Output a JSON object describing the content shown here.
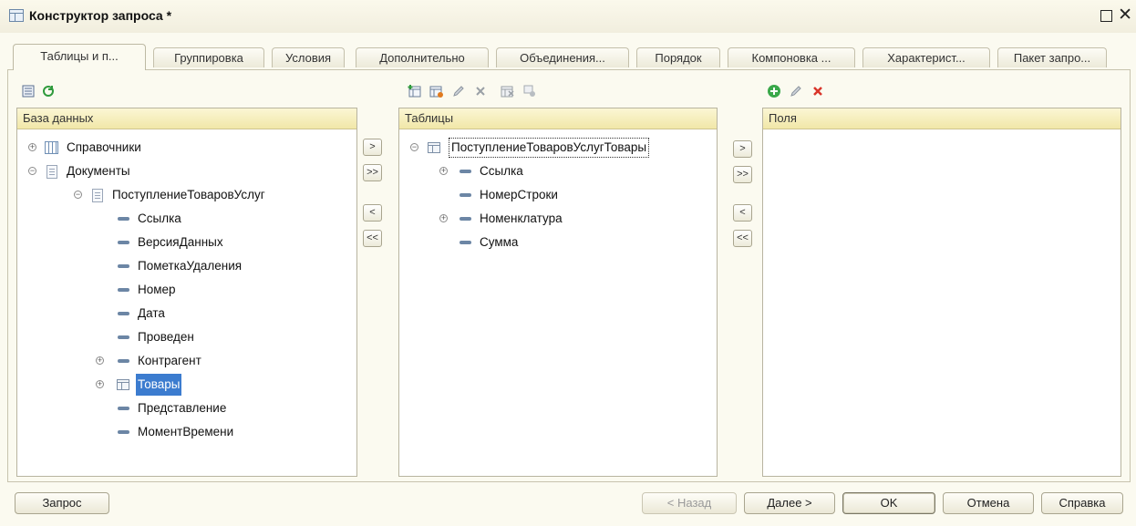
{
  "window": {
    "title": "Конструктор запроса *",
    "maximize_icon": "□",
    "close_icon": "✕"
  },
  "tabs": [
    {
      "label": "Таблицы и п...",
      "active": true
    },
    {
      "label": "Группировка"
    },
    {
      "label": "Условия"
    },
    {
      "label": "Дополнительно"
    },
    {
      "label": "Объединения..."
    },
    {
      "label": "Порядок"
    },
    {
      "label": "Компоновка ..."
    },
    {
      "label": "Характерист..."
    },
    {
      "label": "Пакет запро..."
    }
  ],
  "left_panel": {
    "header": "База данных",
    "toolbar_icons": [
      "query-list-icon",
      "database-refresh-icon"
    ],
    "tree": [
      {
        "label": "Справочники",
        "expander": "⊕",
        "icon": "catalog"
      },
      {
        "label": "Документы",
        "expander": "⊖",
        "icon": "doc"
      },
      {
        "label": "ПоступлениеТоваровУслуг",
        "expander": "⊖",
        "icon": "doc"
      },
      {
        "label": "Ссылка",
        "icon": "field"
      },
      {
        "label": "ВерсияДанных",
        "icon": "field"
      },
      {
        "label": "ПометкаУдаления",
        "icon": "field"
      },
      {
        "label": "Номер",
        "icon": "field"
      },
      {
        "label": "Дата",
        "icon": "field"
      },
      {
        "label": "Проведен",
        "icon": "field"
      },
      {
        "label": "Контрагент",
        "expander": "⊕",
        "icon": "field"
      },
      {
        "label": "Товары",
        "expander": "⊕",
        "icon": "table",
        "selected": true
      },
      {
        "label": "Представление",
        "icon": "field"
      },
      {
        "label": "МоментВремени",
        "icon": "field"
      }
    ]
  },
  "move_buttons_1": {
    "add": ">",
    "add_all": ">>",
    "remove": "<",
    "remove_all": "<<"
  },
  "middle_panel": {
    "header": "Таблицы",
    "toolbar_icons": [
      "add-table-icon",
      "add-nested-query-icon",
      "edit-icon",
      "delete-icon",
      "replace-table-icon",
      "options-icon"
    ],
    "tree": [
      {
        "label": "ПоступлениеТоваровУслугТовары",
        "expander": "⊖",
        "icon": "table",
        "focused": true
      },
      {
        "label": "Ссылка",
        "expander": "⊕",
        "icon": "field"
      },
      {
        "label": "НомерСтроки",
        "icon": "field"
      },
      {
        "label": "Номенклатура",
        "expander": "⊕",
        "icon": "field"
      },
      {
        "label": "Сумма",
        "icon": "field"
      }
    ]
  },
  "move_buttons_2": {
    "add": ">",
    "add_all": ">>",
    "remove": "<",
    "remove_all": "<<"
  },
  "right_panel": {
    "header": "Поля",
    "toolbar_icons": [
      "add-field-icon",
      "edit-field-icon",
      "delete-field-icon"
    ]
  },
  "footer": {
    "query_button": "Запрос",
    "back_button": "< Назад",
    "next_button": "Далее >",
    "ok_button": "OK",
    "cancel_button": "Отмена",
    "help_button": "Справка"
  },
  "colors": {
    "selection": "#3c7ccf",
    "panel_header": "#f1e7a8",
    "window_bg": "#fbfaf0"
  }
}
